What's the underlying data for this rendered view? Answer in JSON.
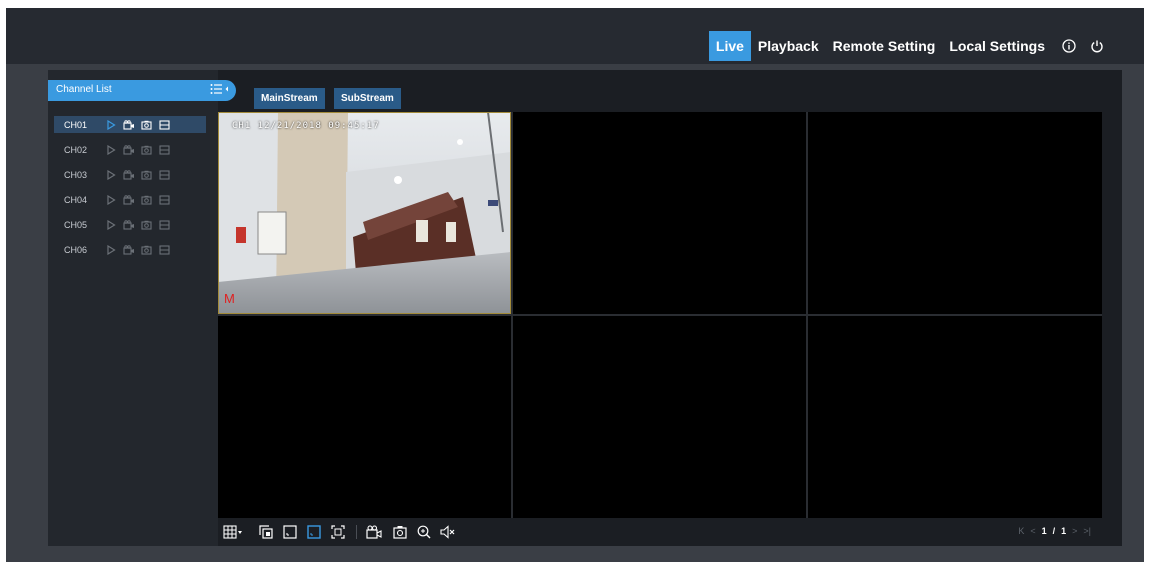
{
  "nav": {
    "items": [
      {
        "label": "Live",
        "active": true
      },
      {
        "label": "Playback",
        "active": false
      },
      {
        "label": "Remote Setting",
        "active": false
      },
      {
        "label": "Local Settings",
        "active": false
      }
    ],
    "icons": [
      "info-icon",
      "power-icon"
    ]
  },
  "channel_list": {
    "title": "Channel List",
    "channels": [
      {
        "name": "CH01",
        "selected": true
      },
      {
        "name": "CH02",
        "selected": false
      },
      {
        "name": "CH03",
        "selected": false
      },
      {
        "name": "CH04",
        "selected": false
      },
      {
        "name": "CH05",
        "selected": false
      },
      {
        "name": "CH06",
        "selected": false
      }
    ],
    "channel_icons": [
      "play-icon",
      "record-icon",
      "snapshot-icon",
      "stream-icon"
    ]
  },
  "stream": {
    "main_label": "MainStream",
    "sub_label": "SubStream"
  },
  "video": {
    "timestamp": "CH1 12/21/2018 09:45:17",
    "motion_marker": "M"
  },
  "toolbar": {
    "icons": [
      "layout-grid-icon",
      "split-view-icon",
      "fit-icon",
      "aspect-ratio-icon",
      "fullscreen-icon",
      "record-all-icon",
      "snapshot-icon",
      "zoom-in-icon",
      "mute-icon"
    ],
    "active_icon": "aspect-ratio-icon"
  },
  "pager": {
    "current": "1",
    "separator": "/",
    "total": "1"
  },
  "colors": {
    "accent": "#3a9ae0",
    "stream_button": "#2a5b88",
    "motion": "#e02020"
  }
}
